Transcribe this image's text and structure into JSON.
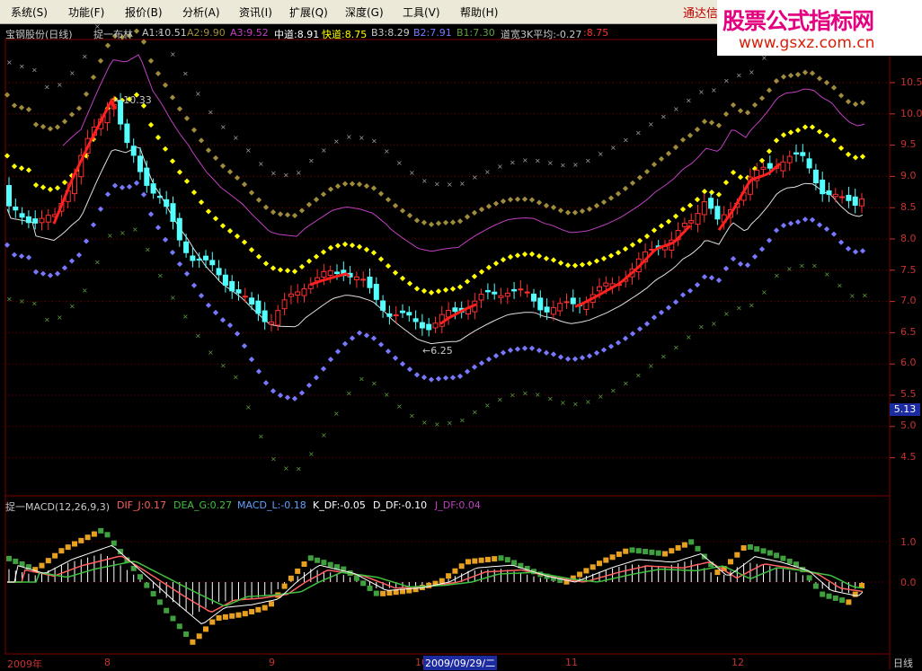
{
  "menu": [
    "系统(S)",
    "功能(F)",
    "报价(B)",
    "分析(A)",
    "资讯(I)",
    "扩展(Q)",
    "深度(G)",
    "工具(V)",
    "帮助(H)"
  ],
  "app_name": "通达信",
  "watermark": {
    "title": "股票公式指标网",
    "url": "www.gsxz.com.cn"
  },
  "stock": {
    "name": "宝钢股份(日线)",
    "indicator": "捉一布林"
  },
  "main_indicators": [
    {
      "text": "A1:10.51",
      "color": "#c8c8c8"
    },
    {
      "text": "A2:9.90",
      "color": "#a08c3c"
    },
    {
      "text": "A3:9.52",
      "color": "#c040c0"
    },
    {
      "text": "中道:8.91",
      "color": "#ffffff"
    },
    {
      "text": "快道:8.75",
      "color": "#ffff00"
    },
    {
      "text": "B3:8.29",
      "color": "#c8c8c8"
    },
    {
      "text": "B2:7.91",
      "color": "#7878ff"
    },
    {
      "text": "B1:7.30",
      "color": "#60a040"
    },
    {
      "text": "道宽3K平均:-0.27",
      "color": "#c8c8c8"
    },
    {
      "text": ":8.75",
      "color": "#ff3030"
    }
  ],
  "sub_indicators": [
    {
      "text": "捉一MACD(12,26,9,3)",
      "color": "#c8c8c8"
    },
    {
      "text": "DIF_J:0.17",
      "color": "#ff6060"
    },
    {
      "text": "DEA_G:0.27",
      "color": "#40c040"
    },
    {
      "text": "MACD_L:-0.18",
      "color": "#60a0ff"
    },
    {
      "text": "K_DF:-0.05",
      "color": "#ffffff"
    },
    {
      "text": "D_DF:-0.10",
      "color": "#ffffff"
    },
    {
      "text": "J_DF:0.04",
      "color": "#c040c0"
    }
  ],
  "price_axis": [
    "10.5",
    "10.0",
    "9.5",
    "9.0",
    "8.5",
    "8.0",
    "7.5",
    "7.0",
    "6.5",
    "6.0",
    "5.5",
    "5.0",
    "4.5"
  ],
  "current_price": "5.13",
  "sub_axis": [
    "1.0",
    "0.0"
  ],
  "annotations": {
    "high": "10.33",
    "low": "6.25"
  },
  "date_axis": [
    "2009年",
    "8",
    "9",
    "10",
    "11",
    "12"
  ],
  "selected_date": "2009/09/29/二",
  "period": "日线",
  "colors": {
    "up": "#ff3030",
    "down": "#54ffff",
    "grid": "#800000",
    "axis_text": "#c83232"
  }
}
